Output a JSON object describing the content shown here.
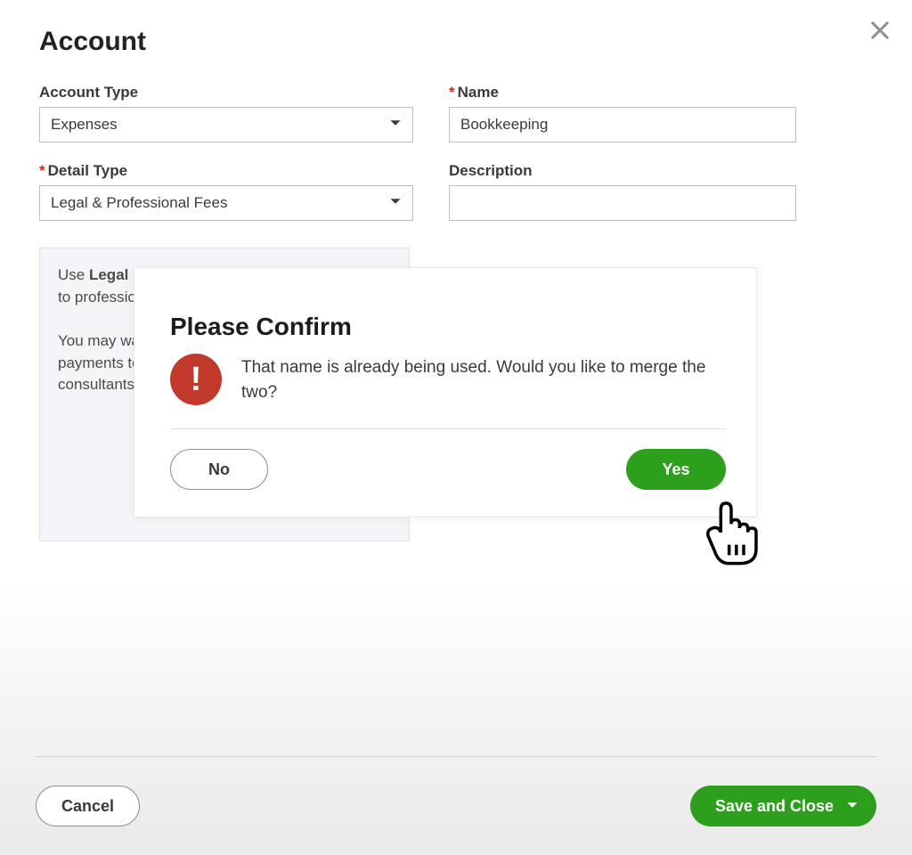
{
  "header": {
    "title": "Account"
  },
  "labels": {
    "account_type": "Account Type",
    "name": "Name",
    "detail_type": "Detail Type",
    "description": "Description"
  },
  "fields": {
    "account_type_value": "Expenses",
    "name_value": "Bookkeeping",
    "detail_type_value": "Legal & Professional Fees",
    "description_value": ""
  },
  "info": {
    "part1_pre": "Use ",
    "part1_bold": "Legal & professional fees",
    "part1_post": " to track money to professionals to help you run your business.",
    "part2": "You may want different accounts of this type for payments to your accountant, lawyer, or other consultants."
  },
  "modal": {
    "title": "Please Confirm",
    "message": "That name is already being used. Would you like to merge the two?",
    "no": "No",
    "yes": "Yes"
  },
  "footer": {
    "cancel": "Cancel",
    "save_close": "Save and Close"
  }
}
